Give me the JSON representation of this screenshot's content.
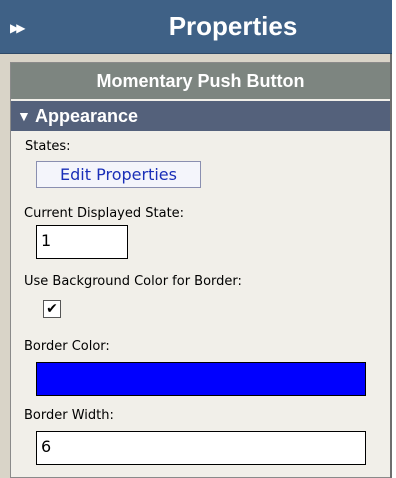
{
  "header": {
    "title": "Properties",
    "collapse_icon": "double-chevron-right-icon"
  },
  "panel": {
    "component_name": "Momentary Push Button",
    "section": {
      "title": "Appearance",
      "expanded": true,
      "icon": "triangle-down-icon"
    },
    "fields": {
      "states_label": "States:",
      "edit_properties_button": "Edit Properties",
      "current_state_label": "Current Displayed State:",
      "current_state_value": "1",
      "use_bg_label": "Use Background Color for Border:",
      "use_bg_checked": true,
      "border_color_label": "Border Color:",
      "border_color_value": "#0000ff",
      "border_width_label": "Border Width:",
      "border_width_value": "6"
    }
  },
  "colors": {
    "titlebar": "#3f6186",
    "subheader": "#7d8580",
    "section_header": "#54617b",
    "panel_bg": "#f1efe9",
    "button_text": "#1a2fb8"
  }
}
